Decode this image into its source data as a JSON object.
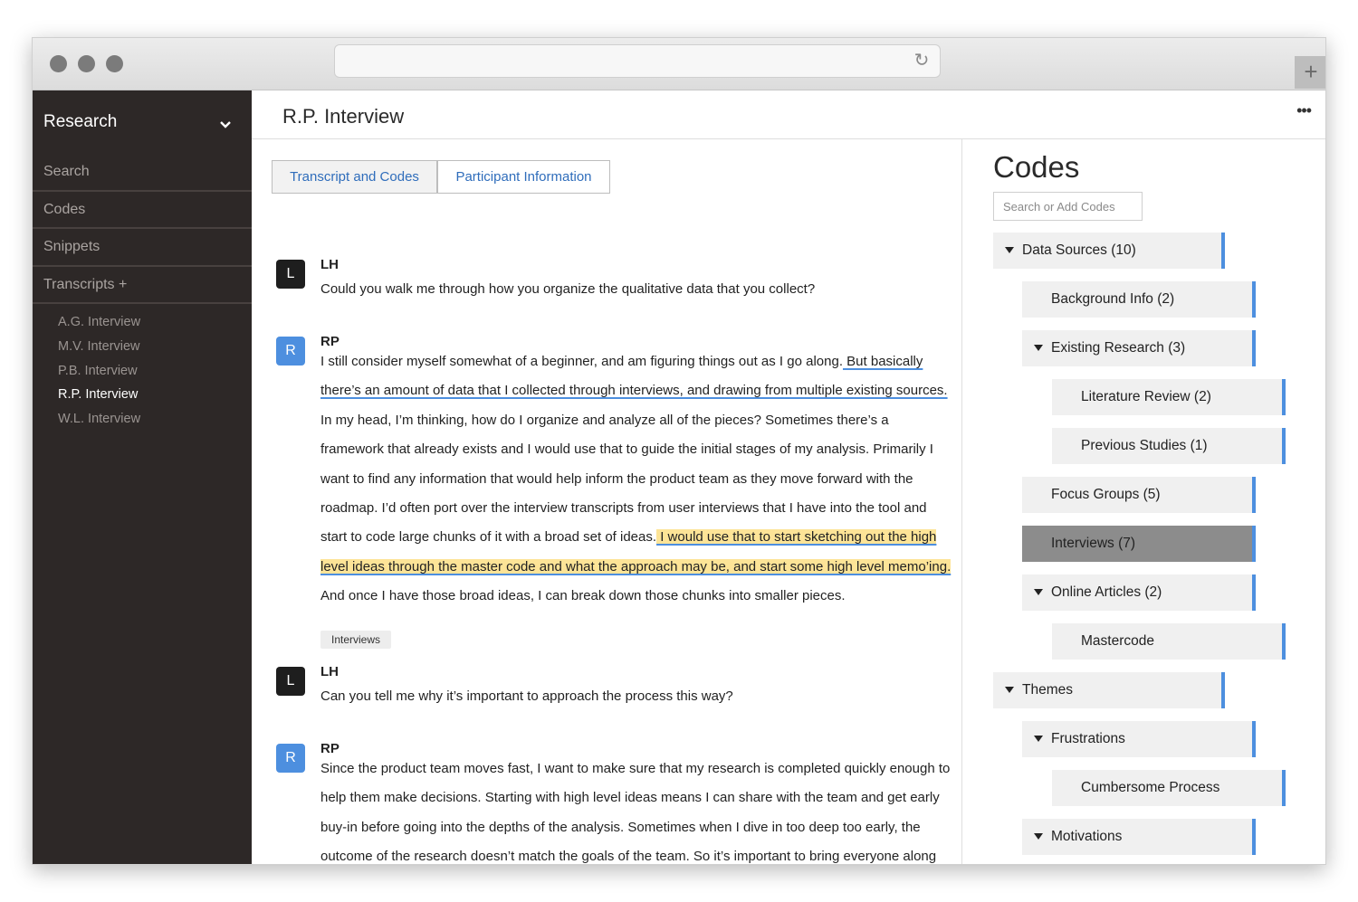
{
  "sidebar": {
    "header": "Research",
    "nav": [
      "Search",
      "Codes",
      "Snippets",
      "Transcripts +"
    ],
    "transcripts": [
      {
        "label": "A.G. Interview",
        "active": false
      },
      {
        "label": "M.V. Interview",
        "active": false
      },
      {
        "label": "P.B. Interview",
        "active": false
      },
      {
        "label": "R.P. Interview",
        "active": true
      },
      {
        "label": "W.L. Interview",
        "active": false
      }
    ]
  },
  "topbar": {
    "title": "R.P. Interview",
    "more": "•••"
  },
  "tabs": [
    {
      "label": "Transcript and Codes",
      "active": true
    },
    {
      "label": "Participant Information",
      "active": false
    }
  ],
  "messages": [
    {
      "avatar": "L",
      "speaker": "LH",
      "text": "Could you walk me through how you organize the qualitative data that you collect?"
    },
    {
      "avatar": "R",
      "speaker": "RP",
      "text_1": "I still consider myself somewhat of a beginner, and am figuring things out as I go along.",
      "text_2": " But basically there’s an amount of data that I collected through interviews, and drawing from multiple existing sources.",
      "text_3": " In my head, I’m thinking, how do I organize and analyze all of the pieces? Sometimes there’s a framework that already exists and I would use that to guide the initial stages of my analysis. Primarily I want to find any information that would help inform the product team as they move forward with the roadmap. I’d often port over the interview transcripts from user interviews that I have into the tool and start to code large chunks of it with a broad set of ideas.",
      "text_4": " I would use that to start sketching out the high level ideas through the master code and what the approach may be, and start some high level memo’ing.",
      "text_5": " And once I have those broad ideas, I can break down those chunks into smaller pieces.",
      "tag": "Interviews"
    },
    {
      "avatar": "L",
      "speaker": "LH",
      "text": "Can you tell me why it’s important to approach the process this way?"
    },
    {
      "avatar": "R",
      "speaker": "RP",
      "text": "Since the product team moves fast, I want to make sure that my research is completed quickly enough to help them make decisions. Starting with high level ideas means I can share with the team and get early buy-in before going into the depths of the analysis. Sometimes when I dive in too deep too early, the outcome of the research doesn’t match the goals of the team. So it’s important to bring everyone along throughout the entire process."
    }
  ],
  "codes": {
    "title": "Codes",
    "search_placeholder": "Search or Add Codes",
    "items": [
      {
        "label": "Data Sources (10)",
        "level": 0,
        "expanded": true,
        "selected": false
      },
      {
        "label": "Background Info (2)",
        "level": 1,
        "expanded": false,
        "selected": false
      },
      {
        "label": "Existing Research (3)",
        "level": 1,
        "expanded": true,
        "selected": false
      },
      {
        "label": "Literature Review (2)",
        "level": 2,
        "expanded": false,
        "selected": false
      },
      {
        "label": "Previous Studies (1)",
        "level": 2,
        "expanded": false,
        "selected": false
      },
      {
        "label": "Focus Groups (5)",
        "level": 1,
        "expanded": false,
        "selected": false
      },
      {
        "label": "Interviews (7)",
        "level": 1,
        "expanded": false,
        "selected": true
      },
      {
        "label": "Online Articles (2)",
        "level": 1,
        "expanded": true,
        "selected": false
      },
      {
        "label": "Mastercode",
        "level": 2,
        "expanded": false,
        "selected": false
      },
      {
        "label": "Themes",
        "level": 0,
        "expanded": true,
        "selected": false
      },
      {
        "label": "Frustrations",
        "level": 1,
        "expanded": true,
        "selected": false
      },
      {
        "label": "Cumbersome Process",
        "level": 2,
        "expanded": false,
        "selected": false
      },
      {
        "label": "Motivations",
        "level": 1,
        "expanded": true,
        "selected": false
      }
    ]
  },
  "colors": {
    "accent": "#4d8fdf",
    "highlight": "#fde497",
    "sidebar": "#2d2827",
    "selected_code": "#8c8c8c"
  }
}
